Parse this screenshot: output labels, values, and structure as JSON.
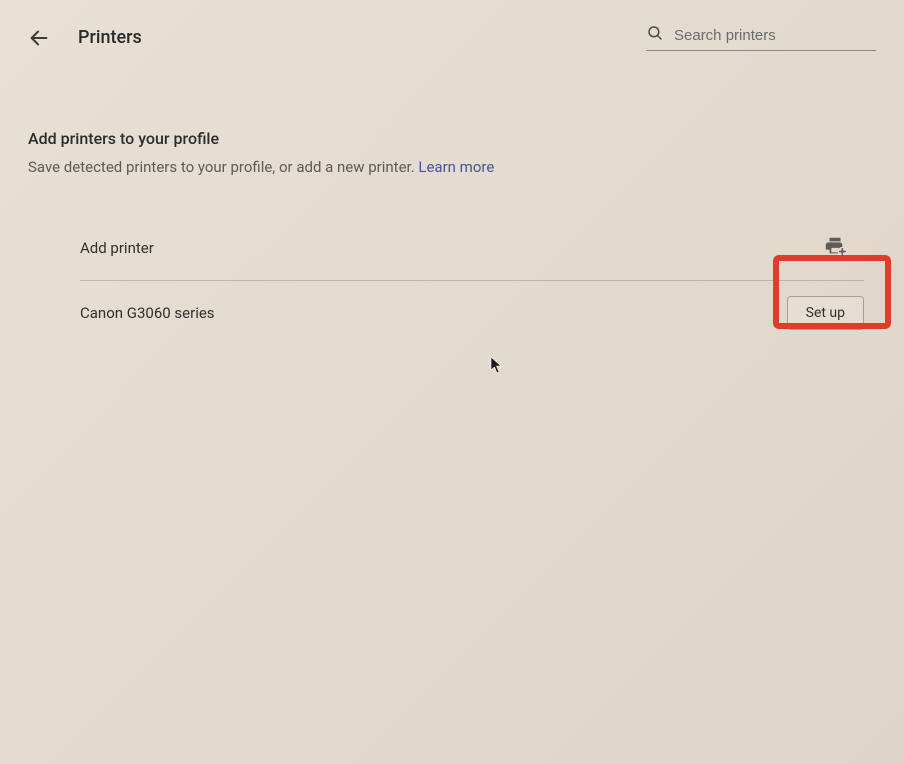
{
  "header": {
    "title": "Printers",
    "search_placeholder": "Search printers"
  },
  "section": {
    "title": "Add printers to your profile",
    "description": "Save detected printers to your profile, or add a new printer. ",
    "learn_more": "Learn more"
  },
  "rows": {
    "add_printer_label": "Add printer",
    "detected_printer_label": "Canon G3060 series",
    "setup_button_label": "Set up"
  }
}
